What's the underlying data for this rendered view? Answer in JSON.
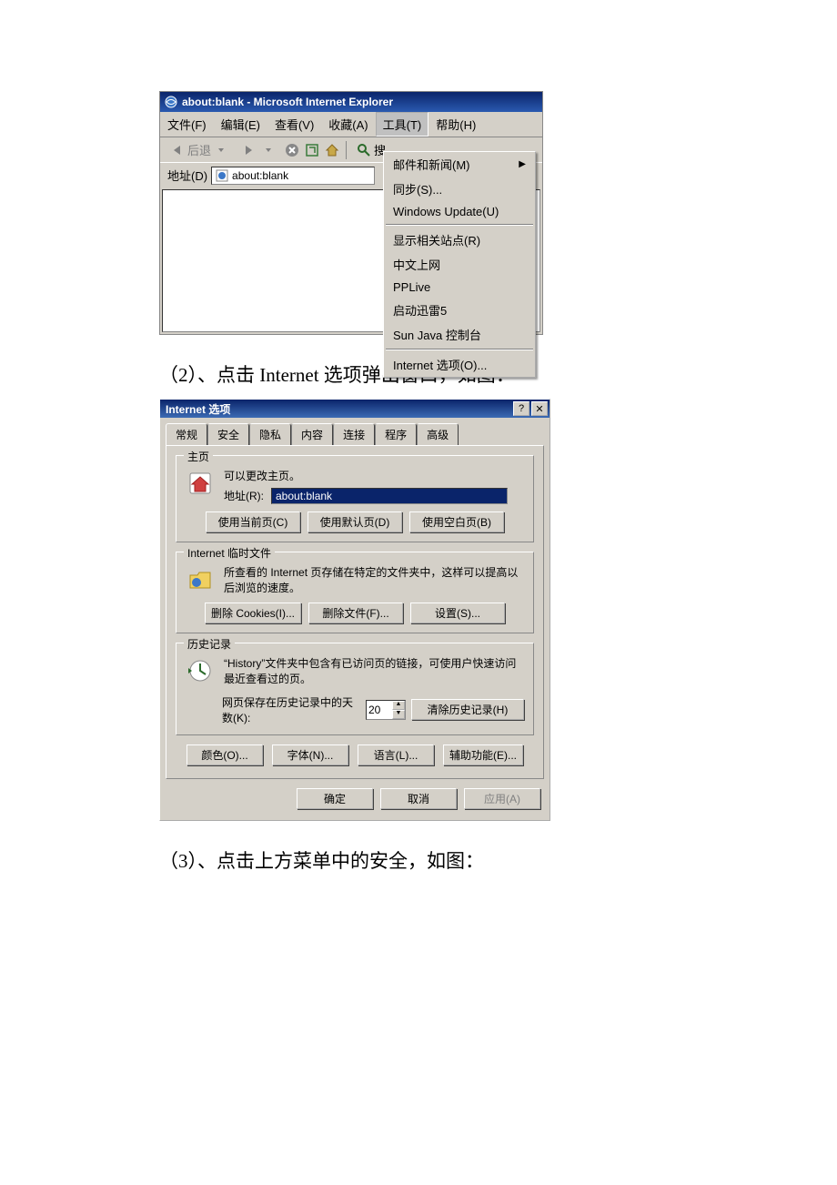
{
  "caption2": "（2）、点击 Internet 选项弹出窗口，如图：",
  "caption3": "（3）、点击上方菜单中的安全，如图：",
  "ie": {
    "title": "about:blank - Microsoft Internet Explorer",
    "menu": {
      "file": "文件(F)",
      "edit": "编辑(E)",
      "view": "查看(V)",
      "fav": "收藏(A)",
      "tools": "工具(T)",
      "help": "帮助(H)"
    },
    "toolbar": {
      "back": "后退",
      "search": "搜"
    },
    "address_label": "地址(D)",
    "address_value": "about:blank",
    "tools_menu": {
      "mail": "邮件和新闻(M)",
      "sync": "同步(S)...",
      "update": "Windows Update(U)",
      "related": "显示相关站点(R)",
      "cnnet": "中文上网",
      "pplive": "PPLive",
      "xunlei": "启动迅雷5",
      "java": "Sun Java 控制台",
      "options": "Internet 选项(O)..."
    }
  },
  "opt": {
    "title": "Internet 选项",
    "tabs": {
      "general": "常规",
      "security": "安全",
      "privacy": "隐私",
      "content": "内容",
      "connections": "连接",
      "programs": "程序",
      "advanced": "高级"
    },
    "home": {
      "legend": "主页",
      "desc": "可以更改主页。",
      "addr_label": "地址(R):",
      "addr_value": "about:blank",
      "btn_current": "使用当前页(C)",
      "btn_default": "使用默认页(D)",
      "btn_blank": "使用空白页(B)"
    },
    "temp": {
      "legend": "Internet 临时文件",
      "desc": "所查看的 Internet 页存储在特定的文件夹中，这样可以提高以后浏览的速度。",
      "btn_cookies": "删除 Cookies(I)...",
      "btn_files": "删除文件(F)...",
      "btn_settings": "设置(S)..."
    },
    "history": {
      "legend": "历史记录",
      "desc": "“History”文件夹中包含有已访问页的链接，可使用户快速访问最近查看过的页。",
      "days_label": "网页保存在历史记录中的天数(K):",
      "days_value": "20",
      "btn_clear": "清除历史记录(H)"
    },
    "bottom": {
      "colors": "颜色(O)...",
      "fonts": "字体(N)...",
      "lang": "语言(L)...",
      "access": "辅助功能(E)..."
    },
    "footer": {
      "ok": "确定",
      "cancel": "取消",
      "apply": "应用(A)"
    }
  }
}
